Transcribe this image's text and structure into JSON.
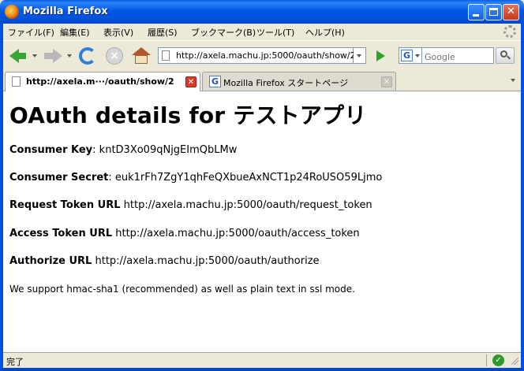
{
  "window": {
    "title": "Mozilla Firefox"
  },
  "menu": [
    "ファイル(F)",
    "編集(E)",
    "表示(V)",
    "履歴(S)",
    "ブックマーク(B)",
    "ツール(T)",
    "ヘルプ(H)"
  ],
  "toolbar": {
    "url": "http://axela.machu.jp:5000/oauth/show/2",
    "search_placeholder": "Google"
  },
  "tabs": [
    {
      "label": "http://axela.m···/oauth/show/2",
      "active": true
    },
    {
      "label": "Mozilla Firefox スタートページ",
      "active": false
    }
  ],
  "page": {
    "title": "OAuth details for テストアプリ",
    "fields": [
      {
        "label": "Consumer Key",
        "value": "kntD3Xo09qNjgEImQbLMw"
      },
      {
        "label": "Consumer Secret",
        "value": "euk1rFh7ZgY1qhFeQXbueAxNCT1p24RoUSO59Ljmo"
      },
      {
        "label": "Request Token URL",
        "value": "http://axela.machu.jp:5000/oauth/request_token"
      },
      {
        "label": "Access Token URL",
        "value": "http://axela.machu.jp:5000/oauth/access_token"
      },
      {
        "label": "Authorize URL",
        "value": "http://axela.machu.jp:5000/oauth/authorize"
      }
    ],
    "note": "We support hmac-sha1 (recommended) as well as plain text in ssl mode."
  },
  "status": {
    "text": "完了"
  },
  "colors": {
    "titlebar": "#0058E6",
    "chrome": "#ECE9D8",
    "go": "#2AA52A",
    "tab_close": "#D83A2A"
  }
}
